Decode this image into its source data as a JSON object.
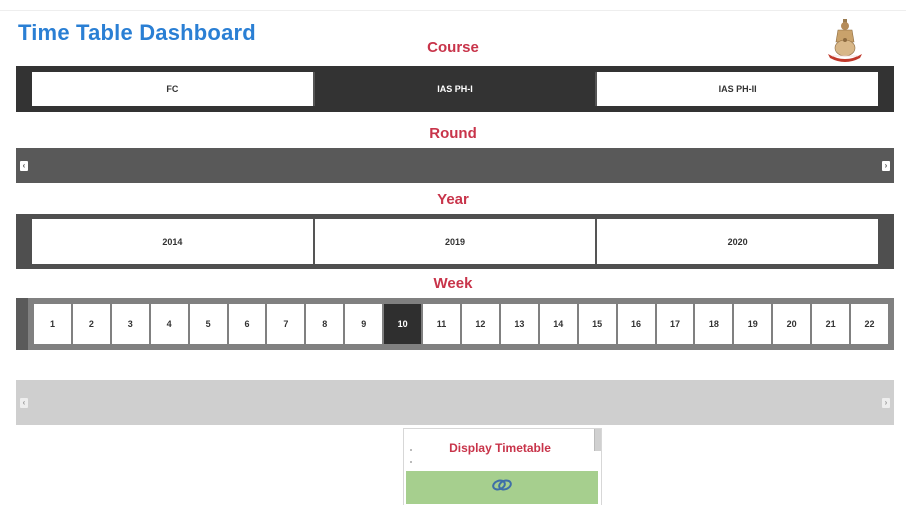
{
  "header": {
    "title": "Time Table Dashboard"
  },
  "logo": {
    "icon": "emblem-icon"
  },
  "course": {
    "label": "Course",
    "items": [
      {
        "label": "FC",
        "selected": false
      },
      {
        "label": "IAS PH-I",
        "selected": true
      },
      {
        "label": "IAS PH-II",
        "selected": false
      }
    ]
  },
  "round": {
    "label": "Round",
    "prev_icon": "chevron-left-icon",
    "next_icon": "chevron-right-icon"
  },
  "year": {
    "label": "Year",
    "items": [
      {
        "label": "2014"
      },
      {
        "label": "2019"
      },
      {
        "label": "2020"
      }
    ]
  },
  "week": {
    "label": "Week",
    "selected": "10",
    "items": [
      "1",
      "2",
      "3",
      "4",
      "5",
      "6",
      "7",
      "8",
      "9",
      "10",
      "11",
      "12",
      "13",
      "14",
      "15",
      "16",
      "17",
      "18",
      "19",
      "20",
      "21",
      "22"
    ]
  },
  "timetable": {
    "label": "Display Timetable",
    "button_icon": "link-icon"
  },
  "colors": {
    "title": "#2a7fd4",
    "label": "#c8344a",
    "selected": "#333333",
    "button": "#a6cf8e"
  }
}
